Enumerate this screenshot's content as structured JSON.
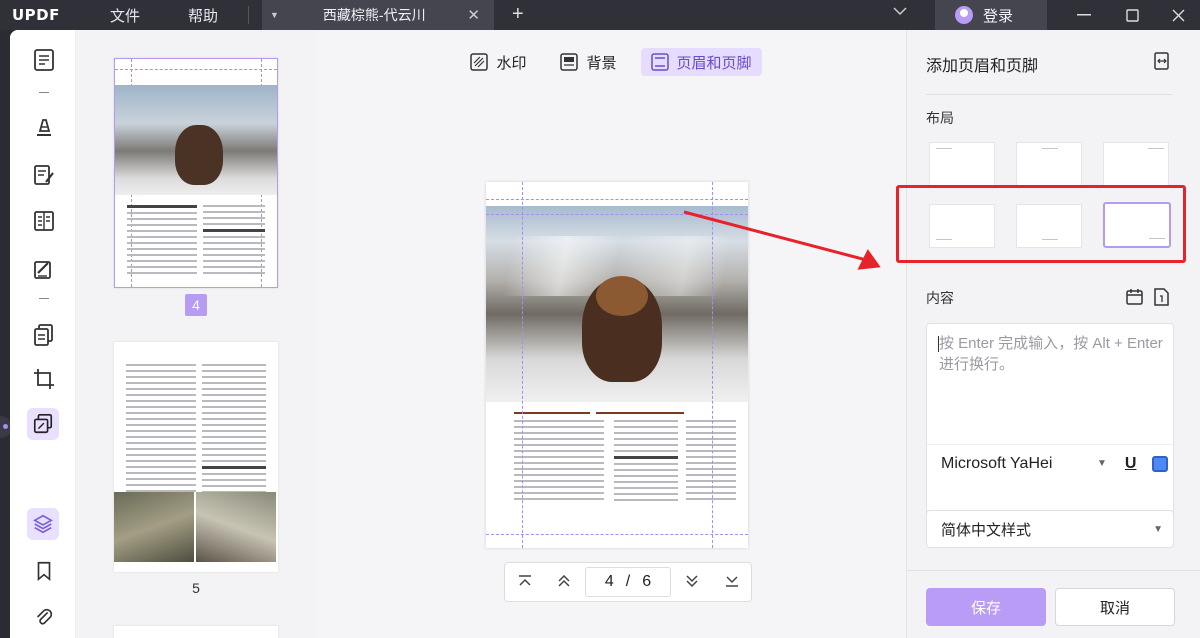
{
  "app": {
    "logo_main": "UPDF",
    "menu": [
      "文件",
      "帮助"
    ],
    "tab_title": "西藏棕熊-代云川",
    "login_label": "登录"
  },
  "thumbnails": [
    {
      "page_label": "4",
      "selected": true
    },
    {
      "page_label": "5",
      "selected": false
    }
  ],
  "main": {
    "tabs": [
      {
        "label": "水印",
        "icon": "watermark-icon",
        "active": false
      },
      {
        "label": "背景",
        "icon": "background-icon",
        "active": false
      },
      {
        "label": "页眉和页脚",
        "icon": "header-footer-icon",
        "active": true
      }
    ],
    "pager": {
      "current": "4",
      "separator": "/",
      "total": "6"
    }
  },
  "panel": {
    "title": "添加页眉和页脚",
    "layout_label": "布局",
    "content_label": "内容",
    "input_placeholder": "按 Enter 完成输入，按 Alt + Enter 进行换行。",
    "font_name": "Microsoft YaHei",
    "underline_label": "U",
    "text_color": "#4b8af5",
    "style_select": "简体中文样式",
    "save_label": "保存",
    "cancel_label": "取消",
    "selected_layout_index": 5
  },
  "colors": {
    "accent": "#b99cf5",
    "highlight_red": "#e8222a",
    "titlebar": "#303039"
  }
}
